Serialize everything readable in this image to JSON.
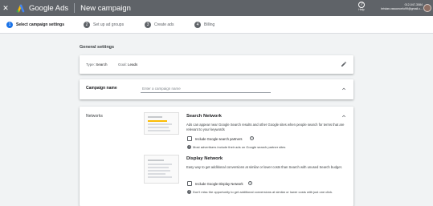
{
  "header": {
    "brand": "Google Ads",
    "page_title": "New campaign",
    "help_label": "Help",
    "account_id": "012-047-3084",
    "account_email": "bristan.vasconcelo99@gmail.c..."
  },
  "stepper": {
    "steps": [
      {
        "num": "1",
        "label": "Select campaign settings"
      },
      {
        "num": "2",
        "label": "Set up ad groups"
      },
      {
        "num": "3",
        "label": "Create ads"
      },
      {
        "num": "4",
        "label": "Billing"
      }
    ]
  },
  "general": {
    "heading": "General settings",
    "type_label": "Type:",
    "type_value": "Search",
    "goal_label": "Goal:",
    "goal_value": "Leads"
  },
  "campaign": {
    "label": "Campaign name",
    "placeholder": "Enter a campaign name",
    "value": ""
  },
  "networks": {
    "label": "Networks",
    "search": {
      "title": "Search Network",
      "description": "Ads can appear near Google Search results and other Google sites when people search for terms that are relevant to your keywords",
      "checkbox_label": "Include Google search partners",
      "checked": false,
      "info": "Most advertisers include their ads on Google search partner sites"
    },
    "display": {
      "title": "Display Network",
      "description": "Easy way to get additional conversions at similar or lower costs than Search with unused Search budget.",
      "checkbox_label": "Include Google Display Network",
      "checked": false,
      "info": "Don't miss the opportunity to get additional conversions at similar or lower costs with just one click."
    }
  },
  "colors": {
    "topbar": "#5f6368",
    "accent": "#1a73e8",
    "background": "#f1f3f4"
  },
  "icons": [
    "close-icon",
    "google-ads-logo-icon",
    "help-icon",
    "avatar",
    "edit-icon",
    "chevron-up-icon",
    "info-icon"
  ]
}
